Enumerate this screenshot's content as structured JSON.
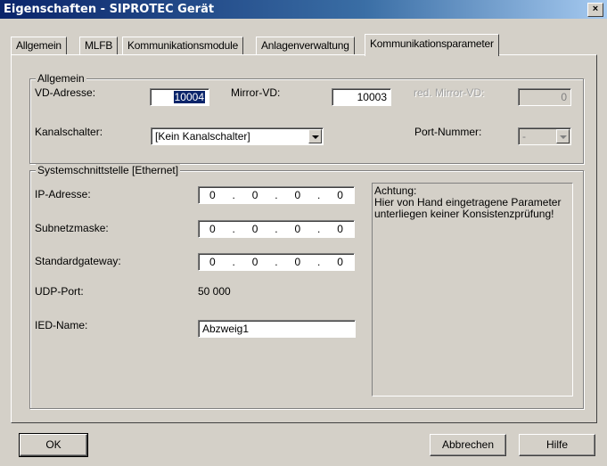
{
  "window": {
    "title": "Eigenschaften - SIPROTEC Gerät",
    "close_glyph": "×"
  },
  "tabs": [
    "Allgemein",
    "MLFB",
    "Kommunikationsmodule",
    "Anlagenverwaltung",
    "Kommunikationsparameter"
  ],
  "allgemein": {
    "group_label": "Allgemein",
    "vd_adresse_label": "VD-Adresse:",
    "vd_adresse_value": "10004",
    "mirror_vd_label": "Mirror-VD:",
    "mirror_vd_value": "10003",
    "red_mirror_vd_label": "red. Mirror-VD:",
    "red_mirror_vd_value": "0",
    "kanalschalter_label": "Kanalschalter:",
    "kanalschalter_value": "[Kein Kanalschalter]",
    "port_nummer_label": "Port-Nummer:",
    "port_nummer_value": "-"
  },
  "systemschnittstelle": {
    "group_label": "Systemschnittstelle [Ethernet]",
    "ip_label": "IP-Adresse:",
    "ip_octets": [
      "0",
      "0",
      "0",
      "0"
    ],
    "subnet_label": "Subnetzmaske:",
    "subnet_octets": [
      "0",
      "0",
      "0",
      "0"
    ],
    "gateway_label": "Standardgateway:",
    "gateway_octets": [
      "0",
      "0",
      "0",
      "0"
    ],
    "udp_label": "UDP-Port:",
    "udp_value": "50 000",
    "ied_label": "IED-Name:",
    "ied_value": "Abzweig1",
    "note_title": "Achtung:",
    "note_line1": "Hier von Hand eingetragene Parameter",
    "note_line2": "unterliegen keiner Konsistenzprüfung!"
  },
  "buttons": {
    "ok": "OK",
    "cancel": "Abbrechen",
    "help": "Hilfe"
  },
  "ip_separator": "."
}
